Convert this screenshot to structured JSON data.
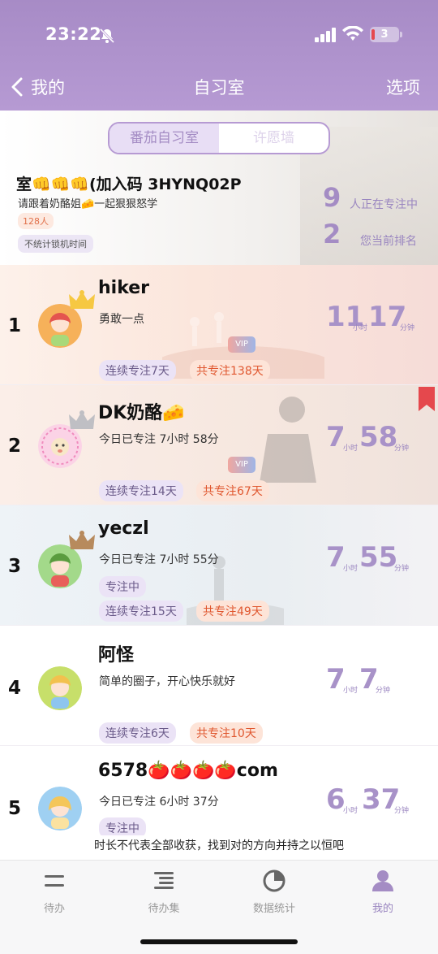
{
  "status": {
    "time": "23:22",
    "battery": "3"
  },
  "nav": {
    "back_label": "我的",
    "title": "自习室",
    "option_label": "选项"
  },
  "segment": {
    "tab1": "番茄自习室",
    "tab2": "许愿墙"
  },
  "room": {
    "name": "室👊👊👊(加入码 3HYNQ02P",
    "desc": "请跟着奶酪姐🧀一起狠狠怒学",
    "count": "128人",
    "lock_note": "不统计锁机时间",
    "focusing_num": "9",
    "focusing_label": "人正在专注中",
    "rank_num": "2",
    "rank_label": "您当前排名"
  },
  "rows": [
    {
      "rank": "1",
      "name": "hiker",
      "motto": "勇敢一点",
      "streak": "连续专注7天",
      "total": "共专注138天",
      "hours": "11",
      "mins": "17",
      "vip": "VIP",
      "status": ""
    },
    {
      "rank": "2",
      "name": "DK奶酪🧀",
      "motto": "今日已专注 7小时 58分",
      "streak": "连续专注14天",
      "total": "共专注67天",
      "hours": "7",
      "mins": "58",
      "vip": "VIP",
      "status": ""
    },
    {
      "rank": "3",
      "name": "yeczl",
      "motto": "今日已专注 7小时 55分",
      "streak": "连续专注15天",
      "total": "共专注49天",
      "hours": "7",
      "mins": "55",
      "vip": "",
      "status": "专注中"
    },
    {
      "rank": "4",
      "name": "阿怪",
      "motto": "简单的圈子，开心快乐就好",
      "streak": "连续专注6天",
      "total": "共专注10天",
      "hours": "7",
      "mins": "7",
      "vip": "",
      "status": ""
    },
    {
      "rank": "5",
      "name": "6578🍅🍅🍅🍅com",
      "motto": "今日已专注 6小时 37分",
      "streak": "",
      "total": "",
      "hours": "6",
      "mins": "37",
      "vip": "",
      "status": "专注中"
    }
  ],
  "units": {
    "hour": "小时",
    "minute": "分钟"
  },
  "banner": "时长不代表全部收获，找到对的方向并持之以恒吧",
  "tabs": [
    {
      "label": "待办",
      "icon": "todo-icon",
      "active": false
    },
    {
      "label": "待办集",
      "icon": "todo-set-icon",
      "active": false
    },
    {
      "label": "数据统计",
      "icon": "pie-chart-icon",
      "active": false
    },
    {
      "label": "我的",
      "icon": "profile-icon",
      "active": true
    }
  ],
  "colors": {
    "brand": "#a78bc6",
    "accent_orange": "#e0572f",
    "bookmark": "#e5484d"
  }
}
